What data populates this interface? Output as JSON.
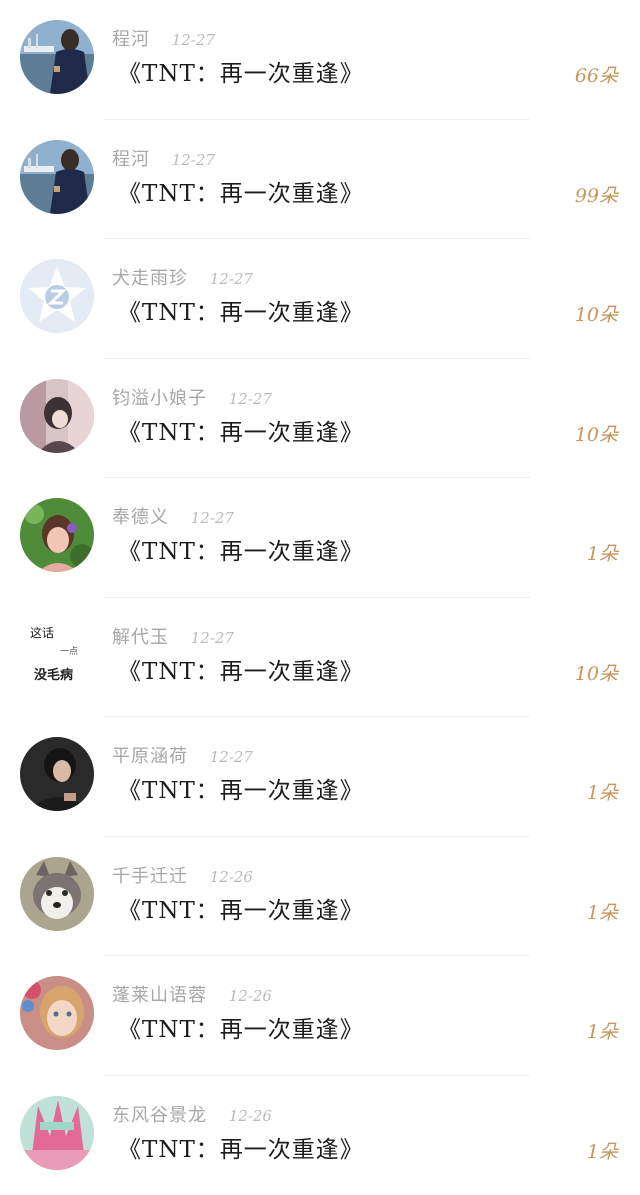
{
  "colors": {
    "accent": "#c9955d",
    "name_text": "#a7a7a7",
    "title_text": "#1c1c1c",
    "divider": "#f0f0f0"
  },
  "items": [
    {
      "name": "程河",
      "date": "12-27",
      "title": "《TNT：再一次重逢》",
      "count": "66朵",
      "avatar": "photo-man-waterfront"
    },
    {
      "name": "程河",
      "date": "12-27",
      "title": "《TNT：再一次重逢》",
      "count": "99朵",
      "avatar": "photo-man-waterfront"
    },
    {
      "name": "犬走雨珍",
      "date": "12-27",
      "title": "《TNT：再一次重逢》",
      "count": "10朵",
      "avatar": "star-z-icon"
    },
    {
      "name": "钧溢小娘子",
      "date": "12-27",
      "title": "《TNT：再一次重逢》",
      "count": "10朵",
      "avatar": "illustration-girl"
    },
    {
      "name": "奉德义",
      "date": "12-27",
      "title": "《TNT：再一次重逢》",
      "count": "1朵",
      "avatar": "photo-girl-flower"
    },
    {
      "name": "解代玉",
      "date": "12-27",
      "title": "《TNT：再一次重逢》",
      "count": "10朵",
      "avatar": "text-image",
      "avatar_text": [
        "这话",
        "一点",
        "没毛病"
      ]
    },
    {
      "name": "平原涵荷",
      "date": "12-27",
      "title": "《TNT：再一次重逢》",
      "count": "1朵",
      "avatar": "photo-person-dark"
    },
    {
      "name": "千手迁迁",
      "date": "12-26",
      "title": "《TNT：再一次重逢》",
      "count": "1朵",
      "avatar": "photo-husky"
    },
    {
      "name": "蓬莱山语蓉",
      "date": "12-26",
      "title": "《TNT：再一次重逢》",
      "count": "1朵",
      "avatar": "photo-child"
    },
    {
      "name": "东风谷景龙",
      "date": "12-26",
      "title": "《TNT：再一次重逢》",
      "count": "1朵",
      "avatar": "anime-pink"
    }
  ]
}
